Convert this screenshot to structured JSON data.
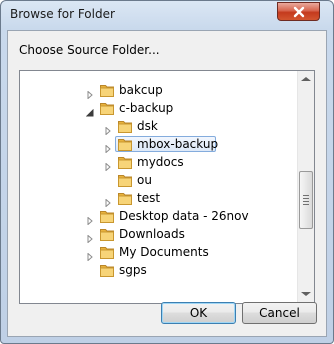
{
  "window": {
    "title": "Browse for Folder"
  },
  "dialog": {
    "prompt": "Choose Source Folder..."
  },
  "tree": {
    "items": [
      {
        "label": "bakcup",
        "level": 0,
        "expander": "collapsed"
      },
      {
        "label": "c-backup",
        "level": 0,
        "expander": "expanded"
      },
      {
        "label": "dsk",
        "level": 1,
        "expander": "collapsed"
      },
      {
        "label": "mbox-backup",
        "level": 1,
        "expander": "collapsed",
        "selected": true
      },
      {
        "label": "mydocs",
        "level": 1,
        "expander": "collapsed"
      },
      {
        "label": "ou",
        "level": 1,
        "expander": "none"
      },
      {
        "label": "test",
        "level": 1,
        "expander": "collapsed"
      },
      {
        "label": "Desktop data - 26nov",
        "level": 0,
        "expander": "collapsed"
      },
      {
        "label": "Downloads",
        "level": 0,
        "expander": "collapsed"
      },
      {
        "label": "My Documents",
        "level": 0,
        "expander": "collapsed"
      },
      {
        "label": "sgps",
        "level": 0,
        "expander": "none"
      }
    ]
  },
  "buttons": {
    "ok": "OK",
    "cancel": "Cancel"
  },
  "icons": {
    "close": "close-icon",
    "folder": "folder-icon",
    "expand": "chevron-right-icon",
    "collapse": "triangle-down-icon"
  },
  "colors": {
    "close_button": "#c43a1e",
    "selection": "#dde9f8",
    "folder": "#f2c14e"
  }
}
